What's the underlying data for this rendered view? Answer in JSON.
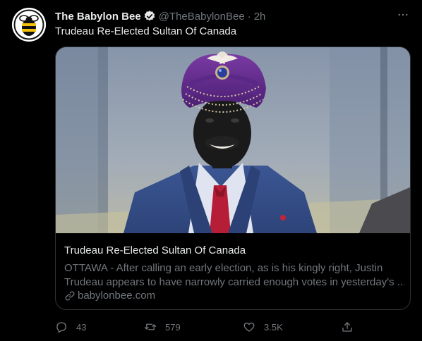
{
  "tweet": {
    "author_name": "The Babylon Bee",
    "author_handle": "@TheBabylonBee",
    "separator": "·",
    "time": "2h",
    "text": "Trudeau Re-Elected Sultan Of Canada",
    "verified": true
  },
  "card": {
    "title": "Trudeau Re-Elected Sultan Of Canada",
    "description_line1": "OTTAWA - After calling an early election, as is his kingly right, Justin",
    "description_line2": "Trudeau appears to have narrowly carried enough votes in yesterday's ...",
    "domain": "babylonbee.com"
  },
  "actions": {
    "replies": "43",
    "retweets": "579",
    "likes": "3.5K"
  },
  "icons": {
    "more": "more-icon",
    "verified": "verified-badge-icon",
    "link": "link-icon",
    "reply": "reply-icon",
    "retweet": "retweet-icon",
    "like": "like-icon",
    "share": "share-icon"
  },
  "colors": {
    "background": "#000000",
    "text_primary": "#e7e9ea",
    "text_secondary": "#71767b",
    "border": "#2f3336",
    "verified": "#e7e9ea"
  }
}
